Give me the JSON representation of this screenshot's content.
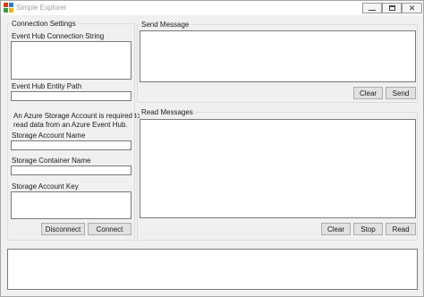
{
  "window": {
    "title": "Simple Explorer"
  },
  "connection": {
    "group_title": "Connection Settings",
    "conn_string_label": "Event Hub Connection String",
    "conn_string_value": "",
    "entity_path_label": "Event Hub Entity Path",
    "entity_path_value": "",
    "storage_info_line1": "An Azure Storage Account is required to",
    "storage_info_line2": "read data from an Azure Event Hub.",
    "account_name_label": "Storage Account Name",
    "account_name_value": "",
    "container_name_label": "Storage Container Name",
    "container_name_value": "",
    "account_key_label": "Storage Account Key",
    "account_key_value": "",
    "disconnect_label": "Disconnect",
    "connect_label": "Connect"
  },
  "send": {
    "group_title": "Send Message",
    "message_value": "",
    "clear_label": "Clear",
    "send_label": "Send"
  },
  "read": {
    "group_title": "Read Messages",
    "messages_value": "",
    "clear_label": "Clear",
    "stop_label": "Stop",
    "read_label": "Read"
  },
  "log": {
    "value": ""
  },
  "colors": {
    "window_bg": "#f0f0f0",
    "field_border": "#7a7a7a",
    "button_bg": "#e1e1e1",
    "title_inactive": "#a0a0a0"
  },
  "icons": {
    "app": "app-icon",
    "minimize": "minimize-icon",
    "maximize": "maximize-icon",
    "close": "close-icon"
  }
}
